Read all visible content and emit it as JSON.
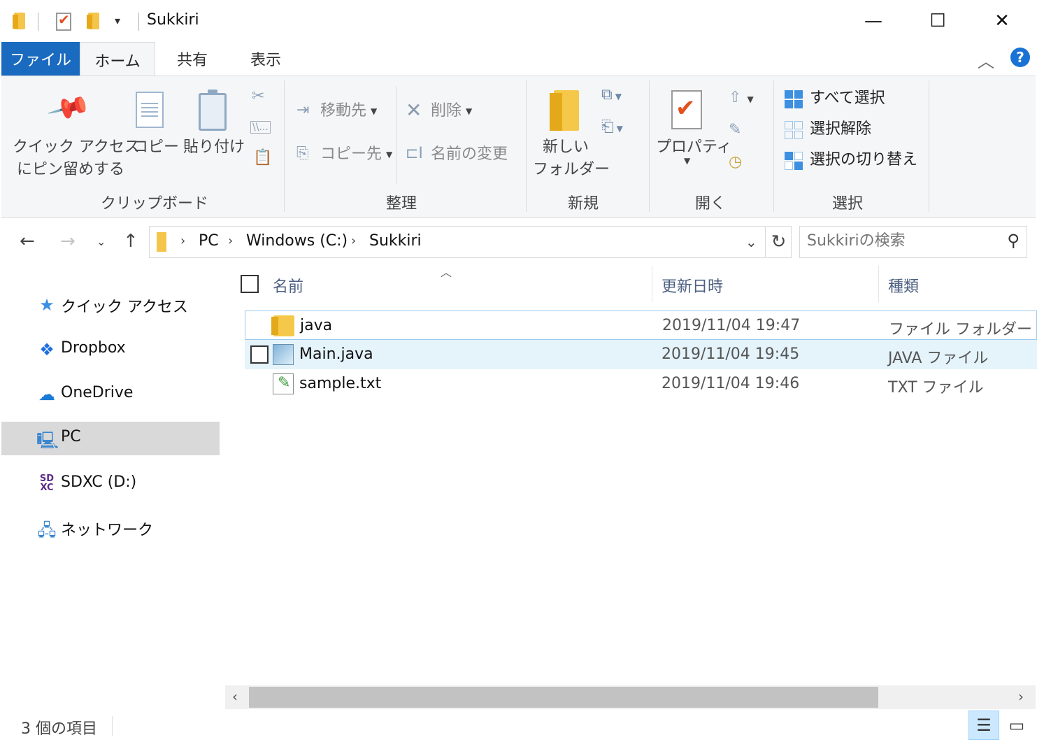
{
  "window": {
    "title": "Sukkiri",
    "minimize": "—",
    "maximize": "☐",
    "close": "✕"
  },
  "tabs": [
    {
      "label": "ファイル"
    },
    {
      "label": "ホーム"
    },
    {
      "label": "共有"
    },
    {
      "label": "表示"
    }
  ],
  "ribbon": {
    "clipboard": {
      "pin_line1": "クイック アクセス",
      "pin_line2": "にピン留めする",
      "copy": "コピー",
      "paste": "貼り付け",
      "label": "クリップボード"
    },
    "organize": {
      "move_to": "移動先",
      "copy_to": "コピー先",
      "delete": "削除",
      "rename": "名前の変更",
      "label": "整理"
    },
    "new": {
      "new_folder_line1": "新しい",
      "new_folder_line2": "フォルダー",
      "label": "新規"
    },
    "open": {
      "properties": "プロパティ",
      "label": "開く"
    },
    "select": {
      "select_all": "すべて選択",
      "select_none": "選択解除",
      "invert": "選択の切り替え",
      "label": "選択"
    }
  },
  "address": {
    "crumbs": [
      "PC",
      "Windows (C:)",
      "Sukkiri"
    ],
    "search_placeholder": "Sukkiriの検索"
  },
  "nav": [
    {
      "label": "クイック アクセス",
      "icon": "star-icon"
    },
    {
      "label": "Dropbox",
      "icon": "dropbox-icon"
    },
    {
      "label": "OneDrive",
      "icon": "cloud-icon"
    },
    {
      "label": "PC",
      "icon": "computer-icon",
      "selected": true
    },
    {
      "label": "SDXC (D:)",
      "icon": "sd-card-icon"
    },
    {
      "label": "ネットワーク",
      "icon": "network-icon"
    }
  ],
  "columns": {
    "name": "名前",
    "date": "更新日時",
    "type": "種類"
  },
  "files": [
    {
      "name": "java",
      "date": "2019/11/04 19:47",
      "type": "ファイル フォルダー",
      "icon": "folder-icon"
    },
    {
      "name": "Main.java",
      "date": "2019/11/04 19:45",
      "type": "JAVA ファイル",
      "icon": "java-file-icon"
    },
    {
      "name": "sample.txt",
      "date": "2019/11/04 19:46",
      "type": "TXT ファイル",
      "icon": "text-file-icon"
    }
  ],
  "status": {
    "item_count": "3 個の項目"
  },
  "colors": {
    "file_tab": "#1a6bbf",
    "selection_hover": "#e5f3fb",
    "nav_selected": "#d9d9d9"
  }
}
